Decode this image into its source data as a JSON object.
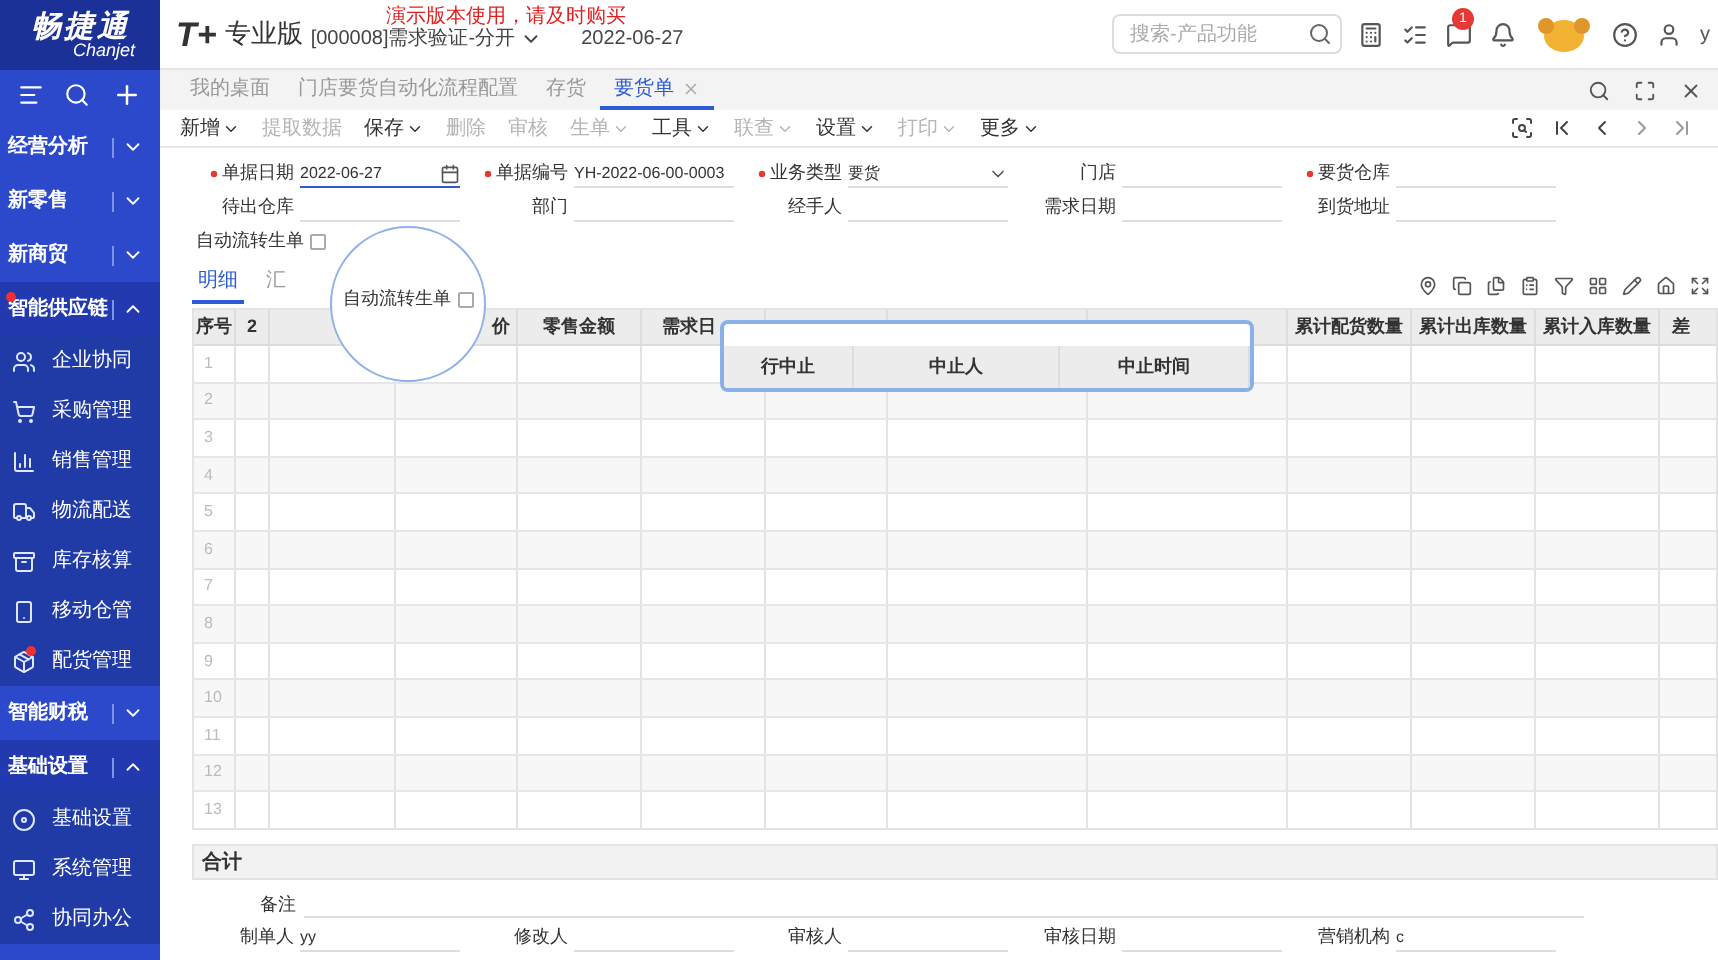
{
  "brand": {
    "name": "畅捷通",
    "sub": "Chanjet"
  },
  "product": {
    "logo": "T+",
    "edition": "专业版",
    "notice": "演示版本使用，请及时购买",
    "account": "[000008]需求验证-分开",
    "date": "2022-06-27"
  },
  "search": {
    "placeholder": "搜索-产品功能"
  },
  "notification_count": "1",
  "user": "y",
  "sidebar": [
    {
      "label": "经营分析",
      "expanded": false,
      "alert": false
    },
    {
      "label": "新零售",
      "expanded": false,
      "alert": false
    },
    {
      "label": "新商贸",
      "expanded": false,
      "alert": false
    },
    {
      "label": "智能供应链",
      "expanded": true,
      "alert": true,
      "children": [
        {
          "label": "企业协同",
          "alert": false
        },
        {
          "label": "采购管理",
          "alert": false
        },
        {
          "label": "销售管理",
          "alert": false
        },
        {
          "label": "物流配送",
          "alert": false
        },
        {
          "label": "库存核算",
          "alert": false
        },
        {
          "label": "移动仓管",
          "alert": false
        },
        {
          "label": "配货管理",
          "alert": true
        }
      ]
    },
    {
      "label": "智能财税",
      "expanded": false,
      "alert": false
    },
    {
      "label": "基础设置",
      "expanded": true,
      "alert": false,
      "children": [
        {
          "label": "基础设置",
          "alert": false
        },
        {
          "label": "系统管理",
          "alert": false
        },
        {
          "label": "协同办公",
          "alert": false
        }
      ]
    }
  ],
  "tabs": [
    {
      "label": "我的桌面",
      "selected": false,
      "closable": false
    },
    {
      "label": "门店要货自动化流程配置",
      "selected": false,
      "closable": false
    },
    {
      "label": "存货",
      "selected": false,
      "closable": false
    },
    {
      "label": "要货单",
      "selected": true,
      "closable": true
    }
  ],
  "toolbar": [
    {
      "label": "新增",
      "dropdown": true,
      "disabled": false
    },
    {
      "label": "提取数据",
      "dropdown": false,
      "disabled": true
    },
    {
      "label": "保存",
      "dropdown": true,
      "disabled": false
    },
    {
      "label": "删除",
      "dropdown": false,
      "disabled": true
    },
    {
      "label": "审核",
      "dropdown": false,
      "disabled": true
    },
    {
      "label": "生单",
      "dropdown": true,
      "disabled": true
    },
    {
      "label": "工具",
      "dropdown": true,
      "disabled": false
    },
    {
      "label": "联查",
      "dropdown": true,
      "disabled": true
    },
    {
      "label": "设置",
      "dropdown": true,
      "disabled": false
    },
    {
      "label": "打印",
      "dropdown": true,
      "disabled": true
    },
    {
      "label": "更多",
      "dropdown": true,
      "disabled": false
    }
  ],
  "form": [
    [
      {
        "label": "单据日期",
        "required": true,
        "value": "2022-06-27",
        "kind": "date"
      },
      {
        "label": "单据编号",
        "required": true,
        "value": "YH-2022-06-00-0003",
        "kind": "text"
      },
      {
        "label": "业务类型",
        "required": true,
        "value": "要货",
        "kind": "select"
      },
      {
        "label": "门店",
        "required": false,
        "kind": "text"
      },
      {
        "label": "要货仓库",
        "required": true,
        "kind": "text"
      }
    ],
    [
      {
        "label": "待出仓库",
        "required": false,
        "kind": "text"
      },
      {
        "label": "部门",
        "required": false,
        "kind": "text"
      },
      {
        "label": "经手人",
        "required": false,
        "kind": "text"
      },
      {
        "label": "需求日期",
        "required": false,
        "kind": "text"
      },
      {
        "label": "到货地址",
        "required": false,
        "kind": "text"
      }
    ]
  ],
  "auto_flow": {
    "label": "自动流转生单",
    "checked": false
  },
  "magnifier": {
    "label": "自动流转生单",
    "checked": false
  },
  "detail_tabs": [
    {
      "label": "明细",
      "selected": true
    },
    {
      "label": "汇",
      "selected": false
    }
  ],
  "table": {
    "columns": [
      {
        "label": "序号"
      },
      {
        "label": "2"
      },
      {},
      {
        "label": "价"
      },
      {
        "label": "零售金额"
      },
      {
        "label": "需求日"
      },
      {},
      {},
      {},
      {
        "label": "累计配货数量"
      },
      {
        "label": "累计出库数量"
      },
      {
        "label": "累计入库数量"
      },
      {
        "label": "差"
      }
    ],
    "rows": [
      "1",
      "2",
      "3",
      "4",
      "5",
      "6",
      "7",
      "8",
      "9",
      "10",
      "11",
      "12",
      "13"
    ]
  },
  "popup": {
    "columns": [
      "行中止",
      "中止人",
      "中止时间"
    ]
  },
  "totals": {
    "label": "合计"
  },
  "remark": {
    "label": "备注"
  },
  "footer": [
    {
      "label": "制单人",
      "value": "yy"
    },
    {
      "label": "修改人"
    },
    {
      "label": "审核人"
    },
    {
      "label": "审核日期"
    },
    {
      "label": "营销机构",
      "value": "c"
    }
  ]
}
